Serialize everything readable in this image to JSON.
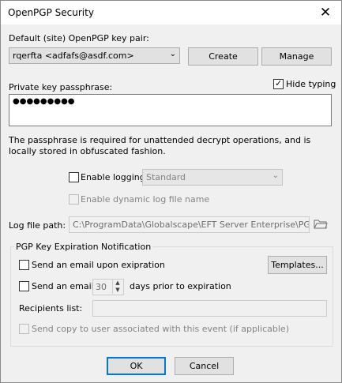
{
  "window": {
    "title": "OpenPGP Security"
  },
  "keypair": {
    "label": "Default (site) OpenPGP key pair:",
    "selected": "rqerfta <adfafs@asdf.com>",
    "create_label": "Create",
    "manage_label": "Manage"
  },
  "passphrase": {
    "label": "Private key passphrase:",
    "hide_typing_label": "Hide typing",
    "hide_typing_checked": true,
    "masked_value": "●●●●●●●●●",
    "info": "The passphrase is required for unattended decrypt operations, and is locally stored in obfuscated fashion."
  },
  "logging": {
    "enable_label": "Enable logging",
    "enable_checked": false,
    "level_selected": "Standard",
    "dynamic_label": "Enable dynamic log file name",
    "dynamic_checked": false,
    "path_label": "Log file path:",
    "path_value": "C:\\ProgramData\\Globalscape\\EFT Server Enterprise\\PGPlog.txt"
  },
  "expiration": {
    "group_title": "PGP Key Expiration Notification",
    "send_on_expiration_label": "Send an email upon exipration",
    "send_on_expiration_checked": false,
    "templates_label": "Templates...",
    "send_prior_label": "Send an email",
    "send_prior_checked": false,
    "days_value": "30",
    "days_suffix": "days prior to expiration",
    "recipients_label": "Recipients list:",
    "recipients_value": "",
    "send_copy_label": "Send copy to user associated with this event (if applicable)",
    "send_copy_checked": false
  },
  "footer": {
    "ok_label": "OK",
    "cancel_label": "Cancel"
  }
}
